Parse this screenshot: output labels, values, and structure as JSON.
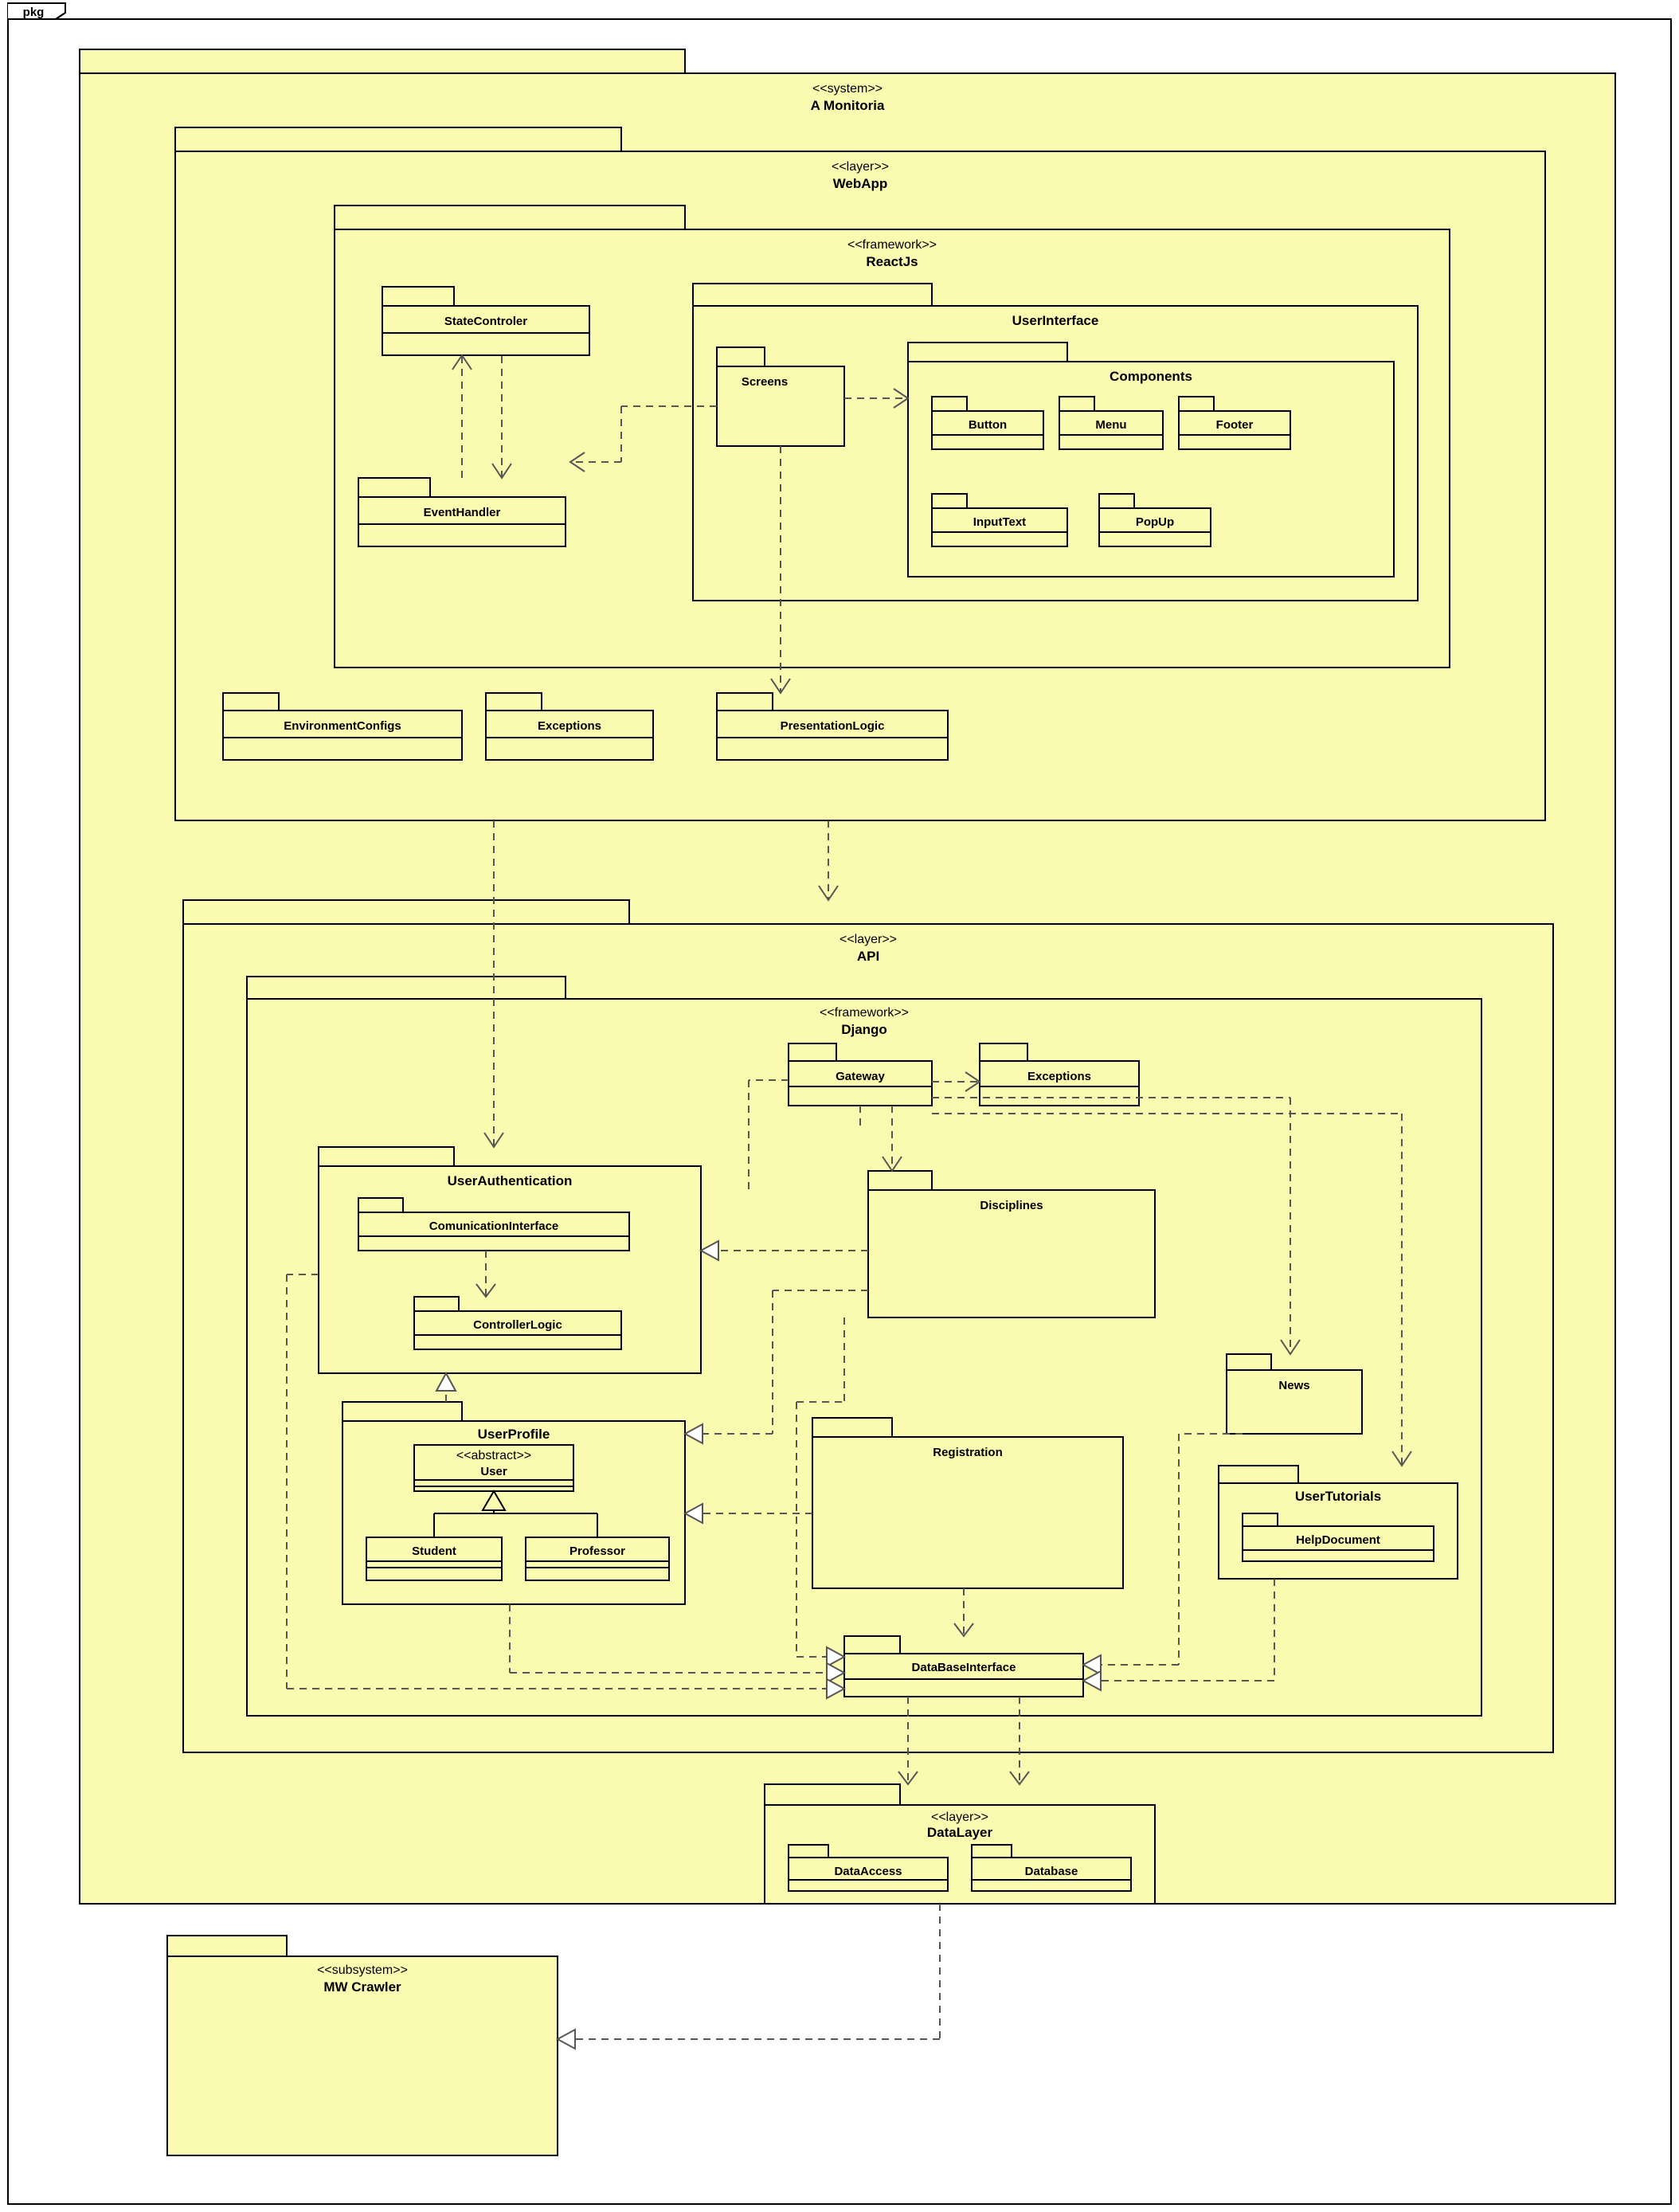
{
  "frame": {
    "tab": "pkg"
  },
  "system": {
    "stereo": "<<system>>",
    "name": "A Monitoria"
  },
  "webapp": {
    "stereo": "<<layer>>",
    "name": "WebApp"
  },
  "reactjs": {
    "stereo": "<<framework>>",
    "name": "ReactJs"
  },
  "ui": {
    "name": "UserInterface"
  },
  "screens": {
    "name": "Screens"
  },
  "components": {
    "name": "Components"
  },
  "button": {
    "name": "Button"
  },
  "menu": {
    "name": "Menu"
  },
  "footer": {
    "name": "Footer"
  },
  "inputtext": {
    "name": "InputText"
  },
  "popup": {
    "name": "PopUp"
  },
  "statecontroler": {
    "name": "StateControler"
  },
  "eventhandler": {
    "name": "EventHandler"
  },
  "envconfigs": {
    "name": "EnvironmentConfigs"
  },
  "exceptions_w": {
    "name": "Exceptions"
  },
  "presentationlogic": {
    "name": "PresentationLogic"
  },
  "api": {
    "stereo": "<<layer>>",
    "name": "API"
  },
  "django": {
    "stereo": "<<framework>>",
    "name": "Django"
  },
  "gateway": {
    "name": "Gateway"
  },
  "exceptions_d": {
    "name": "Exceptions"
  },
  "userauth": {
    "name": "UserAuthentication"
  },
  "cominterface": {
    "name": "ComunicationInterface"
  },
  "controllerlogic": {
    "name": "ControllerLogic"
  },
  "userprofile": {
    "name": "UserProfile"
  },
  "user_abs": {
    "stereo": "<<abstract>>",
    "name": "User"
  },
  "student": {
    "name": "Student"
  },
  "professor": {
    "name": "Professor"
  },
  "disciplines": {
    "name": "Disciplines"
  },
  "registration": {
    "name": "Registration"
  },
  "news": {
    "name": "News"
  },
  "usertutorials": {
    "name": "UserTutorials"
  },
  "helpdocument": {
    "name": "HelpDocument"
  },
  "dbinterface": {
    "name": "DataBaseInterface"
  },
  "datalayer": {
    "stereo": "<<layer>>",
    "name": "DataLayer"
  },
  "dataaccess": {
    "name": "DataAccess"
  },
  "database": {
    "name": "Database"
  },
  "mwcrawler": {
    "stereo": "<<subsystem>>",
    "name": "MW Crawler"
  }
}
